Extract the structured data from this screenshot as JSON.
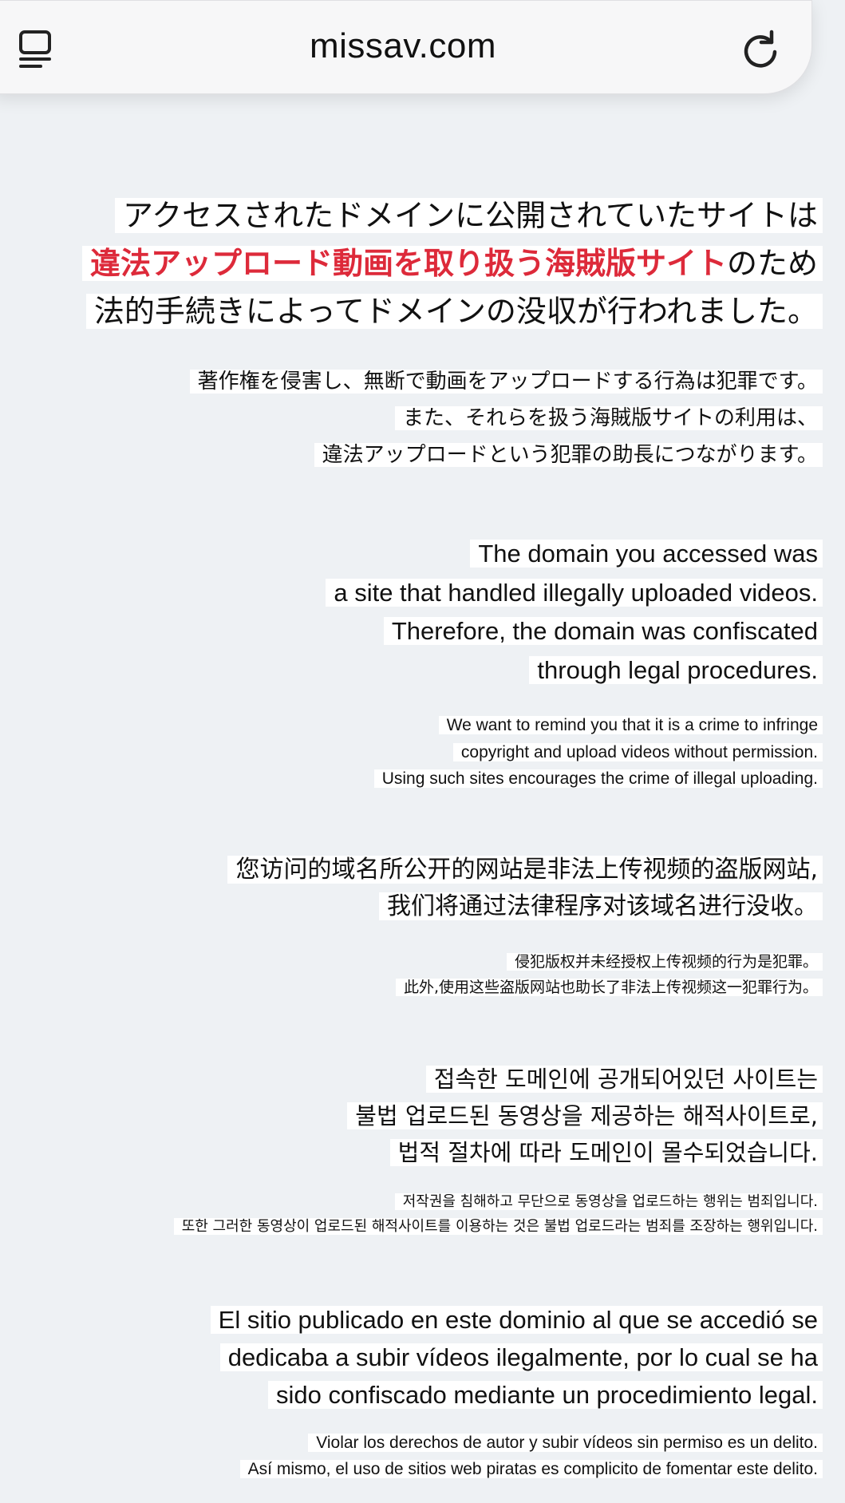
{
  "browser": {
    "url": "missav.com",
    "tabs_icon": "tabs-overview-icon",
    "reload_icon": "reload-icon"
  },
  "colors": {
    "background": "#eef1f4",
    "highlight": "#ffffff",
    "accent_red": "#dd2a3a"
  },
  "japanese": {
    "headline": {
      "line1": "アクセスされたドメインに公開されていたサイトは",
      "line2_red": "違法アップロード動画を取り扱う海賊版サイト",
      "line2_tail": "のため",
      "line3": "法的手続きによってドメインの没収が行われました。"
    },
    "body": {
      "line1": "著作権を侵害し、無断で動画をアップロードする行為は犯罪です。",
      "line2": "また、それらを扱う海賊版サイトの利用は、",
      "line3": "違法アップロードという犯罪の助長につながります。"
    }
  },
  "english": {
    "headline": {
      "line1": "The domain you accessed was",
      "line2": "a site that handled illegally uploaded videos.",
      "line3": "Therefore, the domain was confiscated",
      "line4": "through legal procedures."
    },
    "body": {
      "line1": "We want to remind you that it is a crime to infringe",
      "line2": "copyright and upload videos without permission.",
      "line3": "Using such sites encourages the crime of illegal uploading."
    }
  },
  "chinese": {
    "headline": {
      "line1": "您访问的域名所公开的网站是非法上传视频的盗版网站,",
      "line2": "我们将通过法律程序对该域名进行没收。"
    },
    "body": {
      "line1": "侵犯版权并未经授权上传视频的行为是犯罪。",
      "line2": "此外,使用这些盗版网站也助长了非法上传视频这一犯罪行为。"
    }
  },
  "korean": {
    "headline": {
      "line1": "접속한 도메인에 공개되어있던 사이트는",
      "line2": "불법 업로드된 동영상을 제공하는 해적사이트로,",
      "line3": "법적 절차에 따라 도메인이 몰수되었습니다."
    },
    "body": {
      "line1": "저작권을 침해하고 무단으로 동영상을 업로드하는 행위는 범죄입니다.",
      "line2": "또한 그러한 동영상이 업로드된 해적사이트를 이용하는 것은 불법 업로드라는 범죄를 조장하는 행위입니다."
    }
  },
  "spanish": {
    "headline": {
      "line1": "El sitio publicado en este dominio al que se accedió se",
      "line2": "dedicaba a subir vídeos ilegalmente, por lo cual se ha",
      "line3": "sido confiscado mediante un procedimiento legal."
    },
    "body": {
      "line1": "Violar los derechos de autor y subir vídeos sin permiso es un delito.",
      "line2": "Así mismo, el uso de sitios web piratas es complicito de fomentar este delito."
    }
  }
}
